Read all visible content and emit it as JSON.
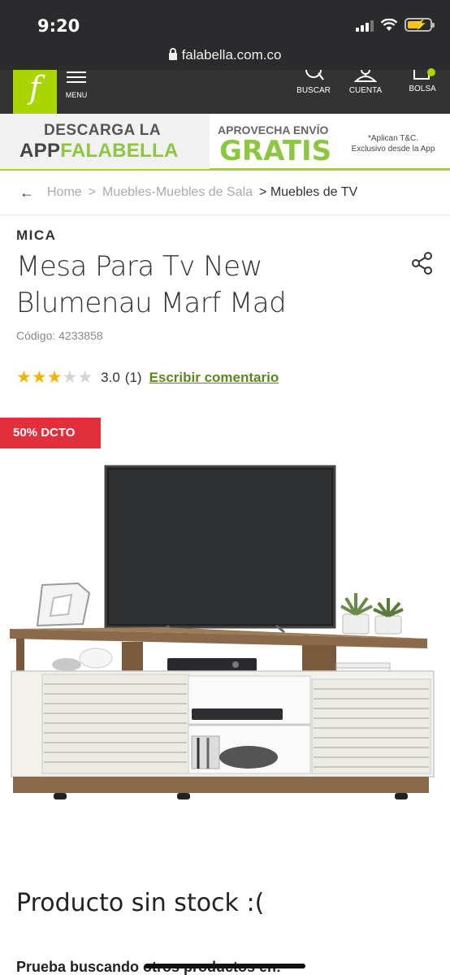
{
  "status_bar": {
    "time": "9:20",
    "url": "falabella.com.co"
  },
  "header": {
    "logo": "f",
    "menu_label": "MENU",
    "search_label": "BUSCAR",
    "account_label": "CUENTA",
    "bag_label": "BOLSA"
  },
  "banner": {
    "line1": "DESCARGA LA",
    "app": "APP",
    "falabella": "FALABELLA",
    "line3": "APROVECHA ENVÍO",
    "line4": "GRATIS",
    "note1": "*Aplican T&C.",
    "note2": "Exclusivo desde la App"
  },
  "breadcrumb": {
    "items": [
      "Home",
      "Muebles-Muebles de Sala"
    ],
    "current": "> Muebles de TV"
  },
  "product": {
    "brand": "MICA",
    "title": "Mesa Para Tv New Blumenau Marf Mad",
    "code": "Código: 4233858",
    "rating": 3.0,
    "rating_text": "3.0",
    "review_count": "(1)",
    "write_review": "Escribir comentario",
    "discount_badge": "50% DCTO",
    "no_stock": "Producto sin stock :(",
    "try_searching": "Prueba buscando otros productos en:"
  },
  "colors": {
    "brand_green": "#aad500",
    "link_green": "#5a8a1a",
    "badge_red": "#e22f3c",
    "star_gold": "#f5b301"
  },
  "icons": [
    "lock-icon",
    "hamburger-menu-icon",
    "search-icon",
    "user-icon",
    "bag-icon",
    "back-arrow-icon",
    "share-icon",
    "star-icon",
    "signal-icon",
    "wifi-icon",
    "battery-icon"
  ]
}
